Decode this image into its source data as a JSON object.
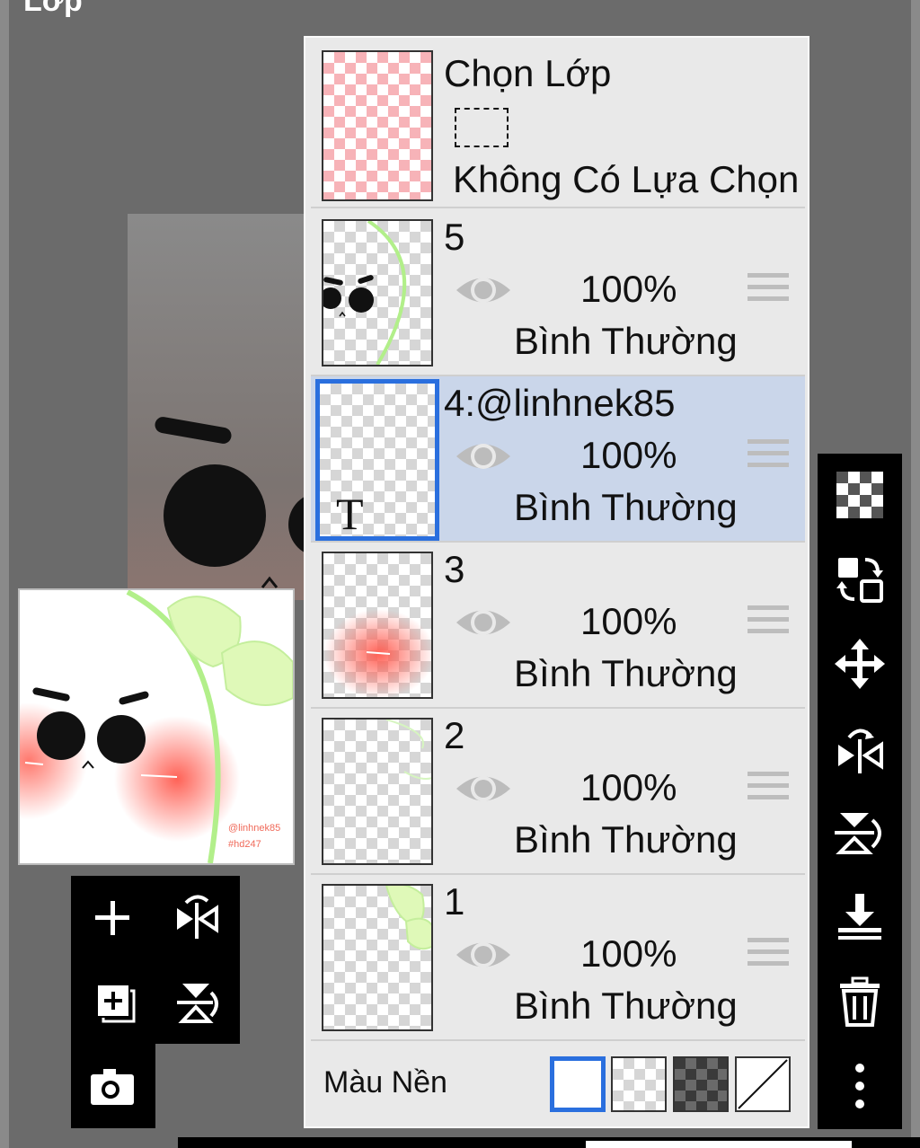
{
  "header": {
    "title": "Lớp"
  },
  "selection_layer": {
    "title": "Chọn Lớp",
    "status": "Không Có Lựa Chọn"
  },
  "layers": [
    {
      "name": "5",
      "opacity": "100%",
      "blend": "Bình Thường",
      "selected": false,
      "visible": true
    },
    {
      "name": "4:@linhnek85",
      "opacity": "100%",
      "blend": "Bình Thường",
      "selected": true,
      "visible": true
    },
    {
      "name": "3",
      "opacity": "100%",
      "blend": "Bình Thường",
      "selected": false,
      "visible": true
    },
    {
      "name": "2",
      "opacity": "100%",
      "blend": "Bình Thường",
      "selected": false,
      "visible": true
    },
    {
      "name": "1",
      "opacity": "100%",
      "blend": "Bình Thường",
      "selected": false,
      "visible": true
    }
  ],
  "text_layer_glyph": "T",
  "background": {
    "label": "Màu Nền",
    "selected_option": "white",
    "options": [
      "white",
      "transparent",
      "dark-checker",
      "none"
    ]
  },
  "preview": {
    "watermark_handle": "@linhnek85",
    "watermark_tag": "#hd247"
  },
  "colors": {
    "accent": "#2a6fde",
    "selected_row": "#cad6ea",
    "panel": "#e9e9e9",
    "toolbar": "#000000"
  }
}
